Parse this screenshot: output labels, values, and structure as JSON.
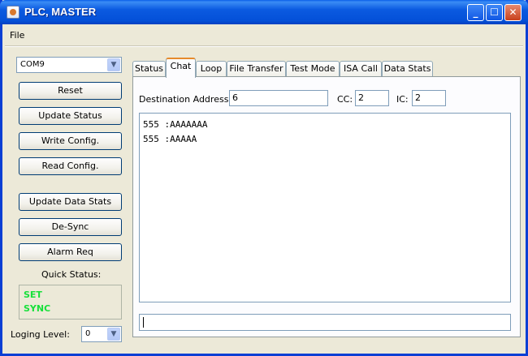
{
  "window": {
    "title": "PLC, MASTER",
    "icons": [
      "java-app-icon",
      "minimize-icon",
      "maximize-icon",
      "close-icon"
    ]
  },
  "menu": {
    "file": "File"
  },
  "sidebar": {
    "port": {
      "selected": "COM9"
    },
    "buttons": {
      "reset": "Reset",
      "update_status": "Update Status",
      "write_config": "Write Config.",
      "read_config": "Read Config.",
      "update_data_stats": "Update Data Stats",
      "de_sync": "De-Sync",
      "alarm_req": "Alarm Req"
    },
    "quick_status": {
      "label": "Quick Status:",
      "lines": [
        "SET",
        "SYNC"
      ],
      "color": "#17e03a"
    },
    "logging": {
      "label": "Loging Level:",
      "selected": "0"
    }
  },
  "tabs": [
    "Status",
    "Chat",
    "Loop",
    "File Transfer",
    "Test Mode",
    "ISA Call",
    "Data Stats"
  ],
  "active_tab": "Chat",
  "chat": {
    "destination_label": "Destination Address:",
    "destination_value": "6",
    "cc_label": "CC:",
    "cc_value": "2",
    "ic_label": "IC:",
    "ic_value": "2",
    "messages": [
      "555 :AAAAAAA",
      "555 :AAAAA"
    ],
    "input_value": ""
  },
  "colors": {
    "titlebar": "#0a5fe8",
    "active_tab_accent": "#e68b2c",
    "window_bg": "#ece9d8"
  }
}
